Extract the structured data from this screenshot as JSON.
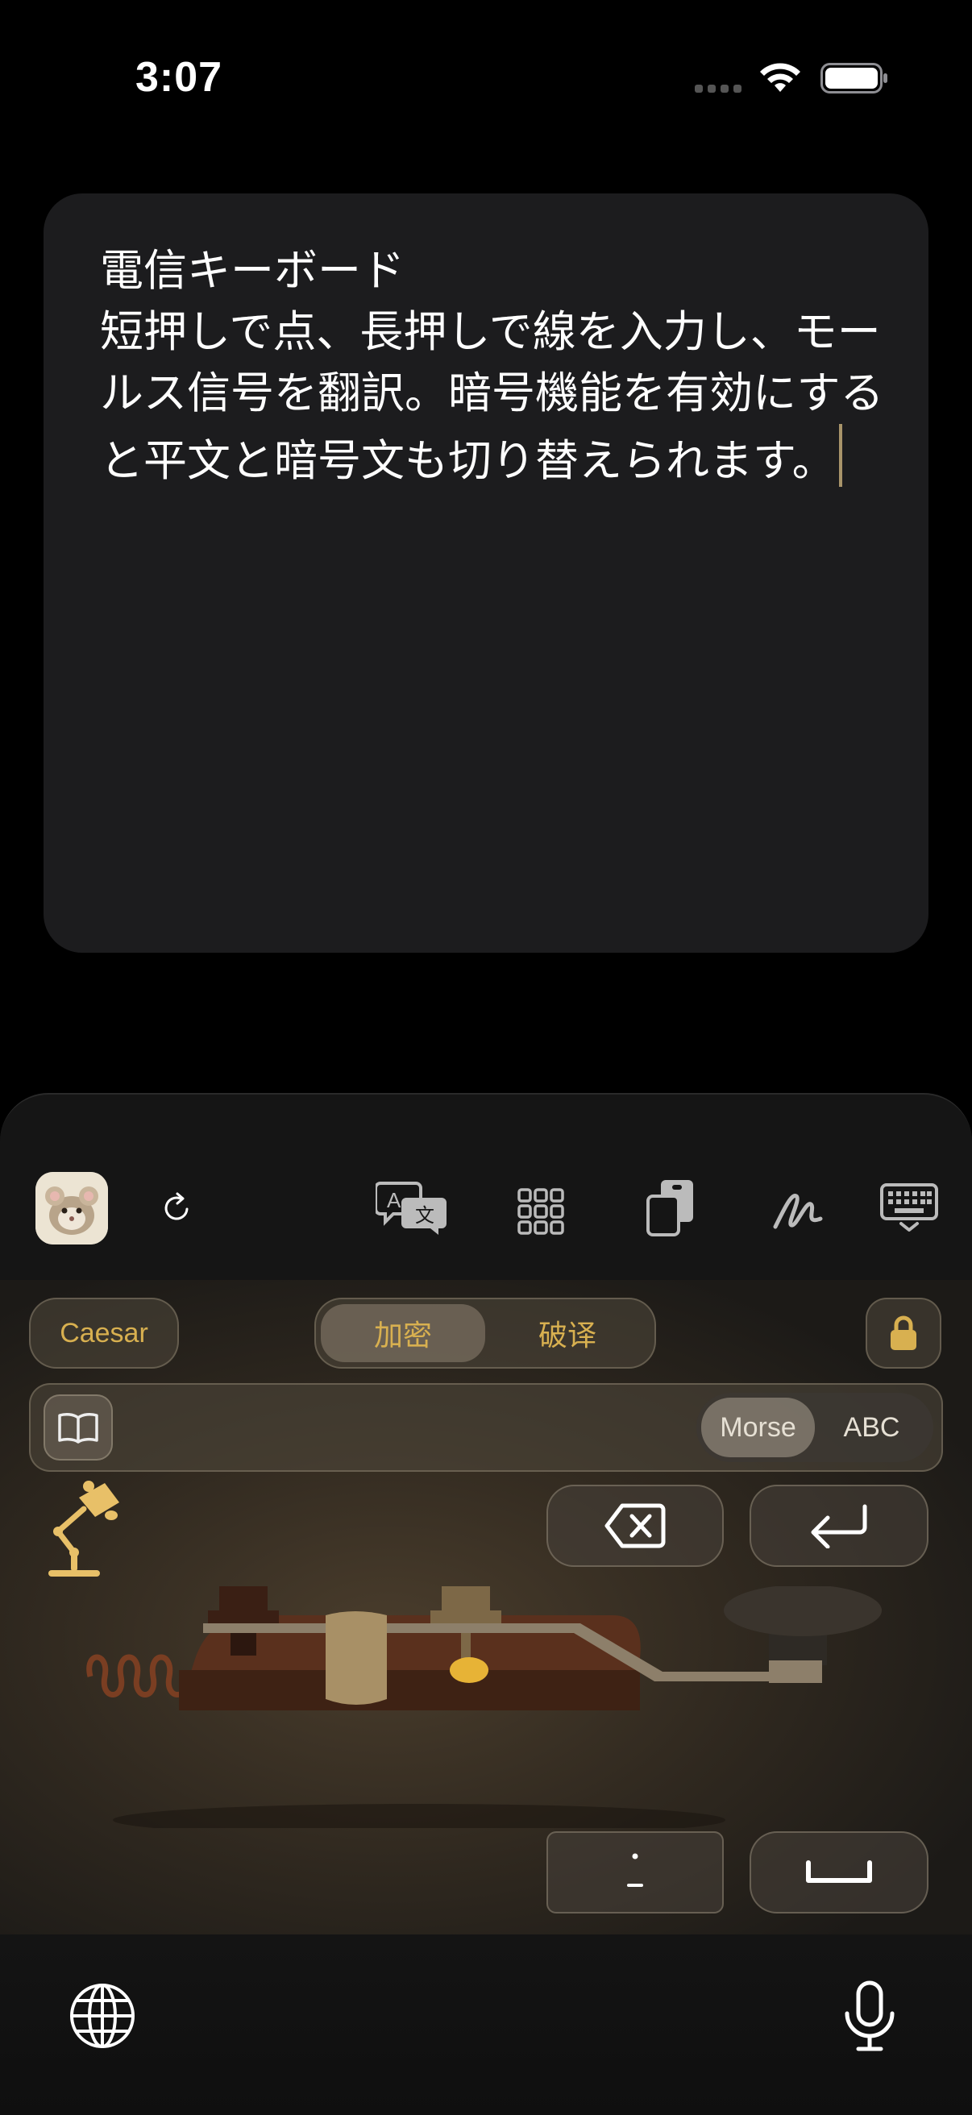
{
  "status_bar": {
    "time": "3:07"
  },
  "note": {
    "title": "電信キーボード",
    "body": "短押しで点、長押しで線を入力し、モールス信号を翻訳。暗号機能を有効にすると平文と暗号文も切り替えられます。"
  },
  "toolbar": {
    "icons": [
      "app-avatar",
      "refresh-icon",
      "translate-icon",
      "grid-icon",
      "clipboard-icon",
      "handwriting-icon",
      "keyboard-icon"
    ]
  },
  "cipher": {
    "method_label": "Caesar",
    "modes": [
      "加密",
      "破译"
    ],
    "active_mode": "加密"
  },
  "input_mode": {
    "options": [
      "Morse",
      "ABC"
    ],
    "active": "Morse"
  },
  "colors": {
    "accent": "#d8b050",
    "panel": "#1c1c1e"
  }
}
